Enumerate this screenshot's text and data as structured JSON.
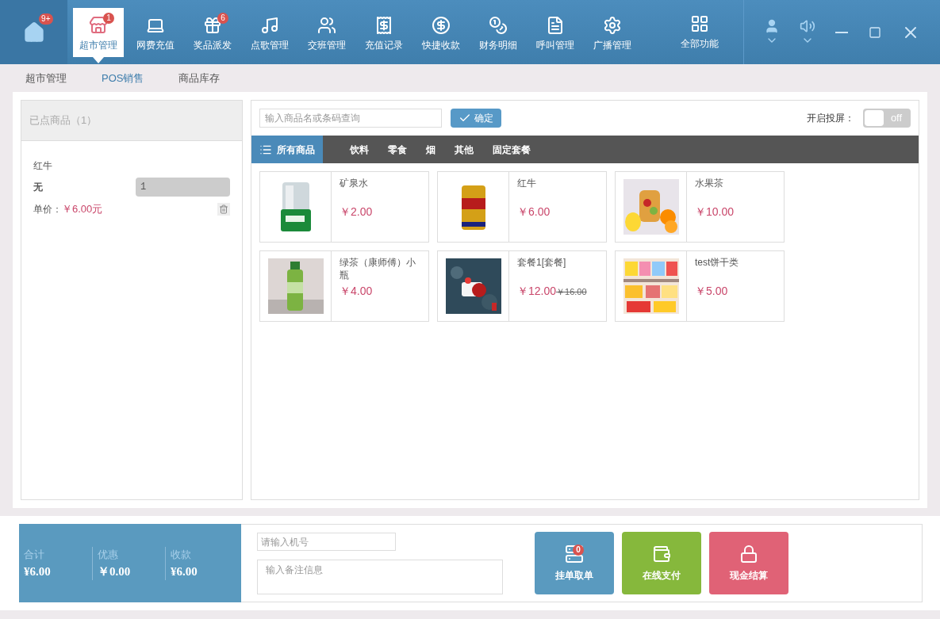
{
  "nav": {
    "home_badge": "9+",
    "items": [
      {
        "label": "超市管理",
        "selected": true,
        "badge": "1"
      },
      {
        "label": "网费充值",
        "selected": false
      },
      {
        "label": "奖品派发",
        "selected": false,
        "badge": "6"
      },
      {
        "label": "点歌管理",
        "selected": false
      },
      {
        "label": "交班管理",
        "selected": false
      },
      {
        "label": "充值记录",
        "selected": false
      },
      {
        "label": "快捷收款",
        "selected": false
      },
      {
        "label": "财务明细",
        "selected": false
      },
      {
        "label": "呼叫管理",
        "selected": false
      },
      {
        "label": "广播管理",
        "selected": false
      }
    ],
    "all_functions": "全部功能"
  },
  "sub_tabs": [
    {
      "label": "超市管理",
      "selected": false
    },
    {
      "label": "POS销售",
      "selected": true
    },
    {
      "label": "商品库存",
      "selected": false
    }
  ],
  "order": {
    "title": "已点商品（1）",
    "items": [
      {
        "name": "红牛",
        "spec": "无",
        "quantity": "1",
        "price_label": "单价：",
        "price": "￥6.00元"
      }
    ]
  },
  "search": {
    "placeholder": "输入商品名或条码查询",
    "button": "确定"
  },
  "cast": {
    "label": "开启投屏：",
    "on": false,
    "text": "off"
  },
  "categories": [
    {
      "label": "所有商品",
      "selected": true
    },
    {
      "label": "饮料",
      "selected": false
    },
    {
      "label": "零食",
      "selected": false
    },
    {
      "label": "烟",
      "selected": false
    },
    {
      "label": "其他",
      "selected": false
    },
    {
      "label": "固定套餐",
      "selected": false
    }
  ],
  "products": [
    {
      "name": "矿泉水",
      "price": "￥2.00"
    },
    {
      "name": "红牛",
      "price": "￥6.00"
    },
    {
      "name": "水果茶",
      "price": "￥10.00"
    },
    {
      "name": "绿茶（康师傅）小瓶",
      "price": "￥4.00"
    },
    {
      "name": "套餐1[套餐]",
      "price": "￥12.00",
      "original_price": "￥16.00"
    },
    {
      "name": "test饼干类",
      "price": "￥5.00"
    }
  ],
  "totals": [
    {
      "label": "合计",
      "value": "¥6.00"
    },
    {
      "label": "优惠",
      "value": "￥0.00"
    },
    {
      "label": "收款",
      "value": "¥6.00"
    }
  ],
  "fields": {
    "machine_placeholder": "请输入机号",
    "note_placeholder": "输入备注信息"
  },
  "actions": [
    {
      "kind": "pending",
      "label": "挂单取单",
      "badge": "0"
    },
    {
      "kind": "online",
      "label": "在线支付"
    },
    {
      "kind": "cash",
      "label": "现金结算"
    }
  ]
}
